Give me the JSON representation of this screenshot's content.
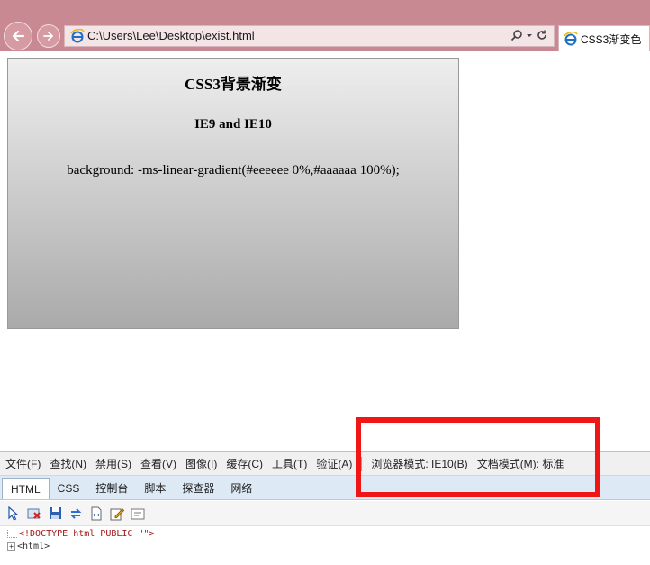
{
  "browser": {
    "address_url": "C:\\Users\\Lee\\Desktop\\exist.html",
    "tab_title": "CSS3渐变色"
  },
  "page": {
    "title": "CSS3背景渐变",
    "subtitle": "IE9 and IE10",
    "code": "background: -ms-linear-gradient(#eeeeee 0%,#aaaaaa 100%);",
    "gradient_start": "#eeeeee",
    "gradient_end": "#aaaaaa"
  },
  "devtools": {
    "menu": [
      "文件(F)",
      "查找(N)",
      "禁用(S)",
      "查看(V)",
      "图像(I)",
      "缓存(C)",
      "工具(T)",
      "验证(A)"
    ],
    "browser_mode": "浏览器模式: IE10(B)",
    "document_mode": "文档模式(M): 标准",
    "tabs": [
      "HTML",
      "CSS",
      "控制台",
      "脚本",
      "探查器",
      "网络"
    ],
    "active_tab": "HTML",
    "toolbar_icons": [
      "select-element-icon",
      "clear-icon",
      "save-icon",
      "refresh-icon",
      "word-wrap-icon",
      "edit-icon",
      "dom-page-icon"
    ],
    "tree": {
      "doctype": "<!DOCTYPE html PUBLIC \"\">",
      "html_node": "<html>"
    }
  },
  "annotation": {
    "highlight_color": "#f01616"
  }
}
